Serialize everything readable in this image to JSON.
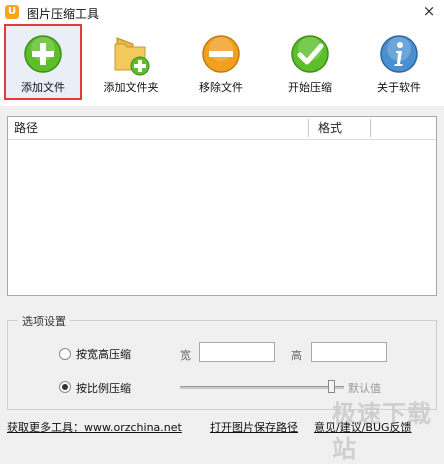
{
  "window": {
    "title": "图片压缩工具",
    "close_symbol": "×"
  },
  "toolbar": {
    "add_file": "添加文件",
    "add_folder": "添加文件夹",
    "remove_file": "移除文件",
    "start_compress": "开始压缩",
    "about": "关于软件"
  },
  "file_list": {
    "columns": [
      "路径",
      "格式"
    ],
    "rows": []
  },
  "options": {
    "group_title": "选项设置",
    "by_size_label": "按宽高压缩",
    "width_label": "宽",
    "height_label": "高",
    "width_value": "",
    "height_value": "",
    "by_ratio_label": "按比例压缩",
    "ratio_value_text": "默认值",
    "ratio_slider_level": 0.9,
    "selected_mode": "by_ratio"
  },
  "footer": {
    "more_tools": "获取更多工具：www.orzchina.net",
    "open_folder": "打开图片保存路径",
    "feedback": "意见/建议/BUG反馈"
  },
  "watermark": "极速下载站",
  "colors": {
    "selected_border": "#e33a3a",
    "add_green": "#5cbf2a",
    "remove_orange": "#f0a020",
    "about_blue": "#4a8fd0"
  },
  "icons": [
    "plus-circle-icon",
    "folder-plus-icon",
    "minus-circle-icon",
    "check-circle-icon",
    "info-circle-icon"
  ]
}
